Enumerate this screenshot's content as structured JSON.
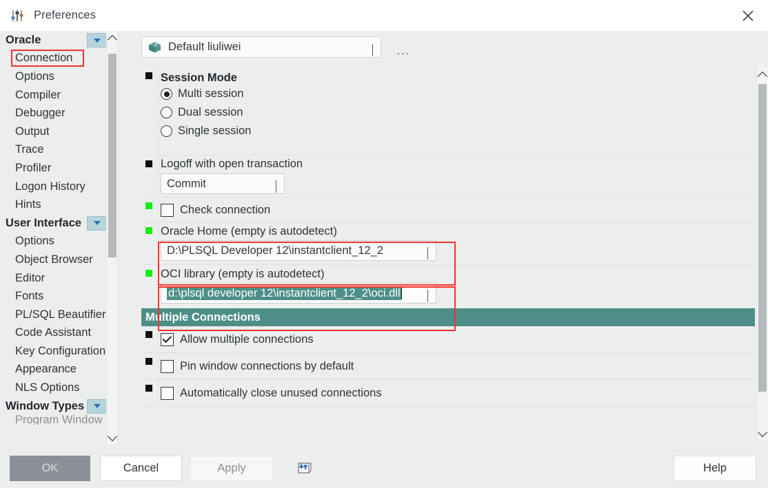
{
  "window": {
    "title": "Preferences",
    "title_icon": "sliders-icon",
    "close_icon": "close-icon"
  },
  "colors": {
    "accent_teal": "#4d8e88",
    "highlight_red": "#f4322c",
    "marker_green": "#15ee15",
    "marker_black": "#0f0f0f",
    "sidebar_bg": "#eceded",
    "collapse_btn_bg": "#b7d4db"
  },
  "sidebar": {
    "groups": [
      {
        "label": "Oracle",
        "collapse_icon": "chevron-down-icon",
        "items": [
          {
            "label": "Connection",
            "highlighted": true
          },
          {
            "label": "Options"
          },
          {
            "label": "Compiler"
          },
          {
            "label": "Debugger"
          },
          {
            "label": "Output"
          },
          {
            "label": "Trace"
          },
          {
            "label": "Profiler"
          },
          {
            "label": "Logon History"
          },
          {
            "label": "Hints"
          }
        ]
      },
      {
        "label": "User Interface",
        "collapse_icon": "chevron-down-icon",
        "items": [
          {
            "label": "Options"
          },
          {
            "label": "Object Browser"
          },
          {
            "label": "Editor"
          },
          {
            "label": "Fonts"
          },
          {
            "label": "PL/SQL Beautifier"
          },
          {
            "label": "Code Assistant"
          },
          {
            "label": "Key Configuration"
          },
          {
            "label": "Appearance"
          },
          {
            "label": "NLS Options"
          }
        ]
      },
      {
        "label": "Window Types",
        "collapse_icon": "chevron-down-icon",
        "items": [
          {
            "label": "Program Window"
          }
        ]
      }
    ],
    "scrollbar": {
      "up_icon": "chevron-up-icon",
      "down_icon": "chevron-down-icon"
    }
  },
  "main": {
    "profile_combo": {
      "icon": "package-box-icon",
      "value": "Default liuliwei",
      "chevron": "chevron-down-icon"
    },
    "more_button": "...",
    "settings": {
      "session_mode": {
        "marker": "black",
        "title": "Session Mode",
        "options": [
          {
            "label": "Multi session",
            "selected": true
          },
          {
            "label": "Dual session",
            "selected": false
          },
          {
            "label": "Single session",
            "selected": false
          }
        ]
      },
      "logoff": {
        "marker": "black",
        "label": "Logoff with open transaction",
        "value": "Commit",
        "chevron": "chevron-down-icon"
      },
      "check_connection": {
        "marker": "green",
        "label": "Check connection",
        "checked": false
      },
      "oracle_home": {
        "marker": "green",
        "label": "Oracle Home (empty is autodetect)",
        "value": "D:\\PLSQL Developer 12\\instantclient_12_2",
        "chevron": "chevron-down-icon",
        "highlighted": true
      },
      "oci_library": {
        "marker": "green",
        "label": "OCI library (empty is autodetect)",
        "value": "d:\\plsql developer 12\\instantclient_12_2\\oci.dll",
        "value_selected": true,
        "chevron": "chevron-down-icon",
        "highlighted": true
      },
      "multiple_connections": {
        "header": "Multiple Connections",
        "checkboxes": [
          {
            "marker": "black",
            "label": "Allow multiple connections",
            "checked": true
          },
          {
            "marker": "black",
            "label": "Pin window connections by default",
            "checked": false
          },
          {
            "marker": "black",
            "label": "Automatically close unused connections",
            "checked": false
          }
        ]
      }
    },
    "scrollbar": {
      "up_icon": "chevron-up-icon",
      "down_icon": "chevron-down-icon"
    }
  },
  "footer": {
    "ok": "OK",
    "cancel": "Cancel",
    "apply": "Apply",
    "help": "Help",
    "import_export_icon": "import-export-icon"
  }
}
